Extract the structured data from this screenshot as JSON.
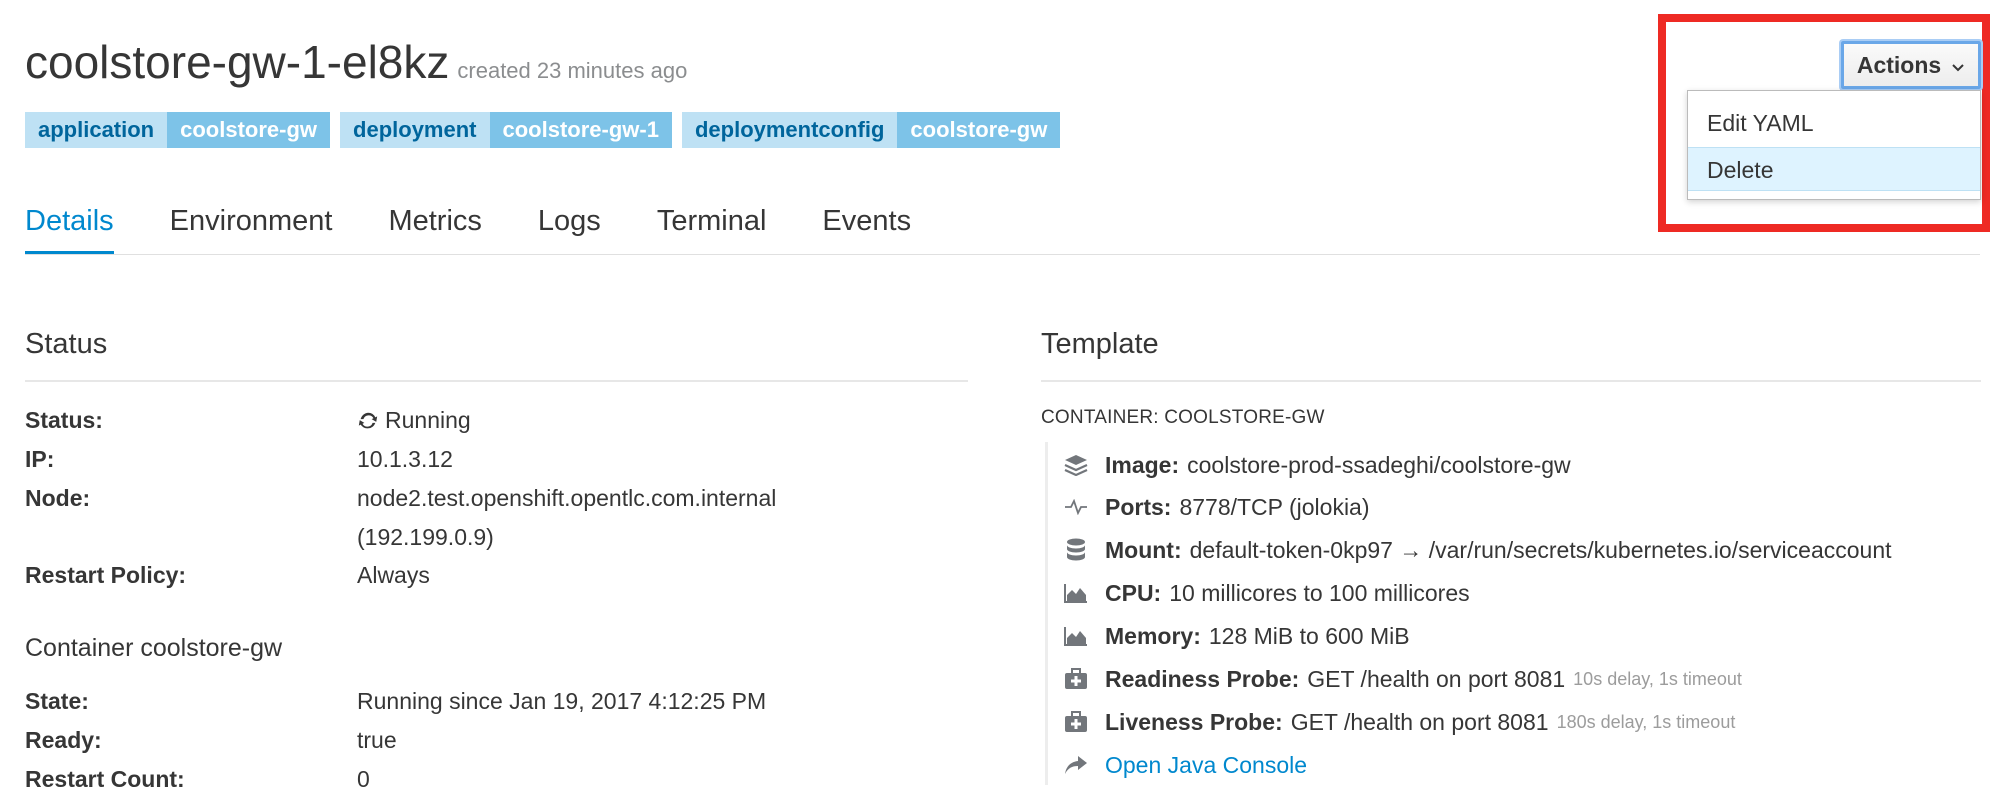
{
  "header": {
    "pod_name": "coolstore-gw-1-el8kz",
    "created": "created 23 minutes ago",
    "labels": [
      {
        "key": "application",
        "value": "coolstore-gw"
      },
      {
        "key": "deployment",
        "value": "coolstore-gw-1"
      },
      {
        "key": "deploymentconfig",
        "value": "coolstore-gw"
      }
    ]
  },
  "tabs": [
    "Details",
    "Environment",
    "Metrics",
    "Logs",
    "Terminal",
    "Events"
  ],
  "active_tab": "Details",
  "actions": {
    "button_label": "Actions",
    "menu": [
      "Edit YAML",
      "Delete"
    ],
    "hovered": "Delete",
    "highlight_color": "#ee2a24"
  },
  "status": {
    "heading": "Status",
    "rows": [
      {
        "label": "Status:",
        "value": "Running"
      },
      {
        "label": "IP:",
        "value": "10.1.3.12"
      },
      {
        "label": "Node:",
        "value": "node2.test.openshift.opentlc.com.internal",
        "value2": "(192.199.0.9)"
      },
      {
        "label": "Restart Policy:",
        "value": "Always"
      }
    ]
  },
  "container": {
    "heading": "Container coolstore-gw",
    "rows": [
      {
        "label": "State:",
        "value": "Running since Jan 19, 2017 4:12:25 PM"
      },
      {
        "label": "Ready:",
        "value": "true"
      },
      {
        "label": "Restart Count:",
        "value": "0"
      }
    ]
  },
  "template": {
    "heading": "Template",
    "caption": "CONTAINER: COOLSTORE-GW",
    "rows": [
      {
        "icon": "image-layers-icon",
        "key": "Image:",
        "value": "coolstore-prod-ssadeghi/coolstore-gw"
      },
      {
        "icon": "ports-pulse-icon",
        "key": "Ports:",
        "value": "8778/TCP (jolokia)"
      },
      {
        "icon": "mount-database-icon",
        "key": "Mount:",
        "value": "default-token-0kp97 → /var/run/secrets/kubernetes.io/serviceaccount"
      },
      {
        "icon": "cpu-area-chart-icon",
        "key": "CPU:",
        "value": "10 millicores to 100 millicores"
      },
      {
        "icon": "memory-area-chart-icon",
        "key": "Memory:",
        "value": "128 MiB to 600 MiB"
      },
      {
        "icon": "readiness-probe-medkit-icon",
        "key": "Readiness Probe:",
        "value": "GET /health on port 8081",
        "note": "10s delay, 1s timeout"
      },
      {
        "icon": "liveness-probe-medkit-icon",
        "key": "Liveness Probe:",
        "value": "GET /health on port 8081",
        "note": "180s delay, 1s timeout"
      }
    ],
    "link": {
      "icon": "share-arrow-icon",
      "label": "Open Java Console"
    }
  }
}
